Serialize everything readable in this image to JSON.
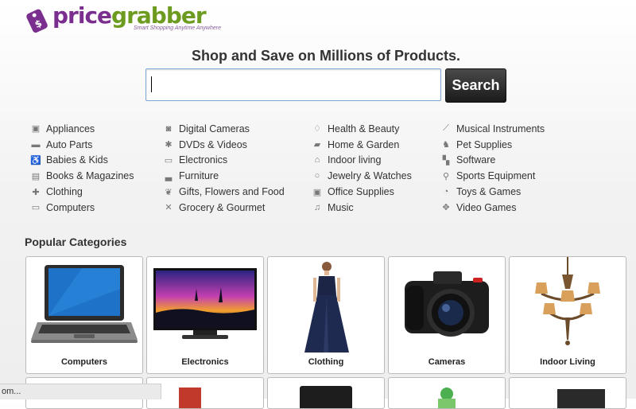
{
  "brand": {
    "logo_text_a": "price",
    "logo_text_b": "grabber",
    "tagline": "Smart Shopping Anytime Anywhere",
    "primary_color": "#7a2f8f",
    "secondary_color": "#6d9b1f"
  },
  "hero": {
    "headline": "Shop and Save on Millions of Products.",
    "search_value": "",
    "search_button": "Search"
  },
  "categories": {
    "columns": [
      [
        {
          "label": "Appliances",
          "icon": "appliance-icon"
        },
        {
          "label": "Auto Parts",
          "icon": "car-icon"
        },
        {
          "label": "Babies & Kids",
          "icon": "stroller-icon"
        },
        {
          "label": "Books & Magazines",
          "icon": "book-icon"
        },
        {
          "label": "Clothing",
          "icon": "shirt-icon"
        },
        {
          "label": "Computers",
          "icon": "laptop-icon"
        }
      ],
      [
        {
          "label": "Digital Cameras",
          "icon": "camera-icon"
        },
        {
          "label": "DVDs & Videos",
          "icon": "film-icon"
        },
        {
          "label": "Electronics",
          "icon": "monitor-icon"
        },
        {
          "label": "Furniture",
          "icon": "sofa-icon"
        },
        {
          "label": "Gifts, Flowers and Food",
          "icon": "gift-icon"
        },
        {
          "label": "Grocery & Gourmet",
          "icon": "utensils-icon"
        }
      ],
      [
        {
          "label": "Health & Beauty",
          "icon": "health-icon"
        },
        {
          "label": "Home & Garden",
          "icon": "garden-icon"
        },
        {
          "label": "Indoor living",
          "icon": "house-icon"
        },
        {
          "label": "Jewelry & Watches",
          "icon": "ring-icon"
        },
        {
          "label": "Office Supplies",
          "icon": "briefcase-icon"
        },
        {
          "label": "Music",
          "icon": "music-note-icon"
        }
      ],
      [
        {
          "label": "Musical Instruments",
          "icon": "guitar-icon"
        },
        {
          "label": "Pet Supplies",
          "icon": "dog-icon"
        },
        {
          "label": "Software",
          "icon": "software-icon"
        },
        {
          "label": "Sports Equipment",
          "icon": "sports-icon"
        },
        {
          "label": "Toys & Games",
          "icon": "toy-icon"
        },
        {
          "label": "Video Games",
          "icon": "gamepad-icon"
        }
      ]
    ]
  },
  "popular": {
    "title": "Popular Categories",
    "tiles": [
      {
        "label": "Computers",
        "image": "laptop-image"
      },
      {
        "label": "Electronics",
        "image": "tv-image"
      },
      {
        "label": "Clothing",
        "image": "dress-image"
      },
      {
        "label": "Cameras",
        "image": "camera-image"
      },
      {
        "label": "Indoor Living",
        "image": "chandelier-image"
      }
    ]
  },
  "status_bar": {
    "text": "om..."
  }
}
